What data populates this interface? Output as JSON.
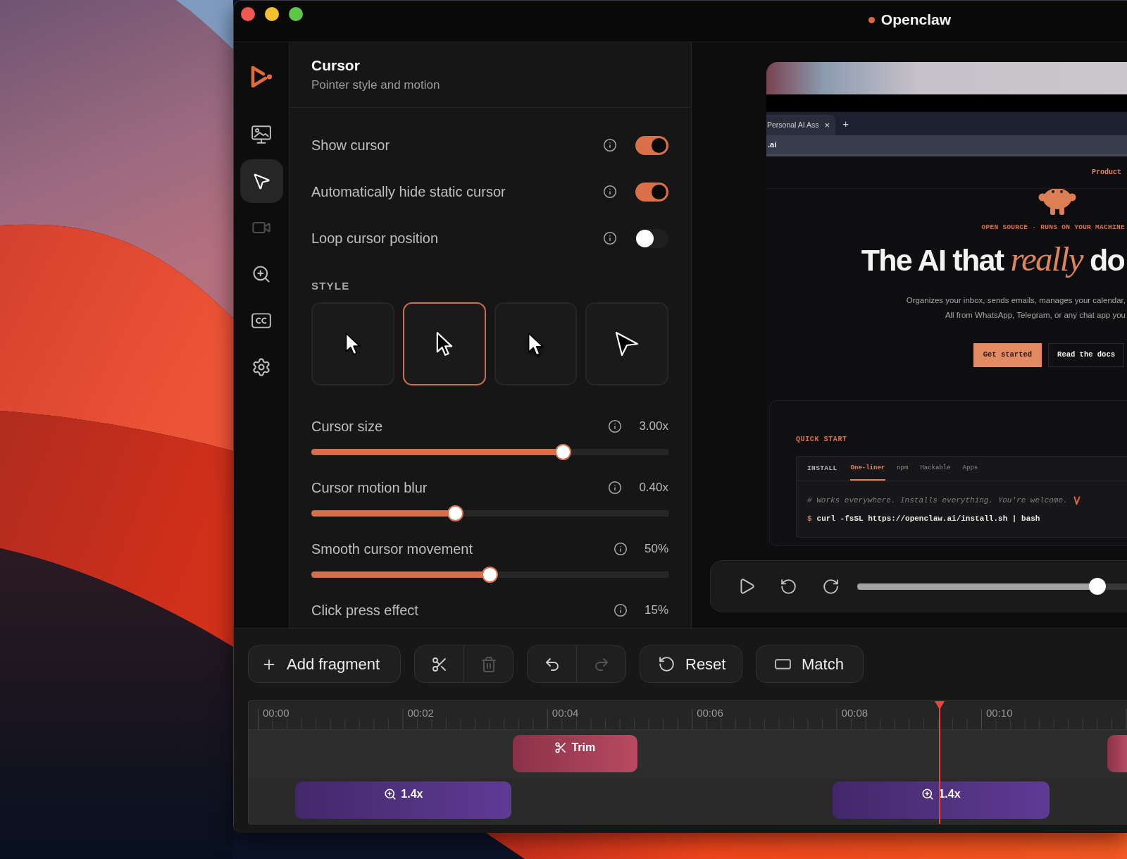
{
  "window": {
    "title": "Openclaw"
  },
  "sidebar": {
    "items": [
      {
        "selected": false,
        "disabled": false
      },
      {
        "selected": true,
        "disabled": false
      },
      {
        "selected": false,
        "disabled": true
      },
      {
        "selected": false,
        "disabled": false
      },
      {
        "selected": false,
        "disabled": false
      },
      {
        "selected": false,
        "disabled": false
      }
    ]
  },
  "panel": {
    "title": "Cursor",
    "subtitle": "Pointer style and motion",
    "toggles": [
      {
        "label": "Show cursor",
        "on": true
      },
      {
        "label": "Automatically hide static cursor",
        "on": true
      },
      {
        "label": "Loop cursor position",
        "on": false
      }
    ],
    "style": {
      "label": "STYLE",
      "options": [
        {
          "selected": false
        },
        {
          "selected": true
        },
        {
          "selected": false
        },
        {
          "selected": false
        }
      ]
    },
    "sliders": [
      {
        "label": "Cursor size",
        "reading": "3.00x",
        "level": 0.706
      },
      {
        "label": "Cursor motion blur",
        "reading": "0.40x",
        "level": 0.404
      },
      {
        "label": "Smooth cursor movement",
        "reading": "50%",
        "level": 0.5
      },
      {
        "label": "Click press effect",
        "reading": "15%"
      }
    ]
  },
  "preview": {
    "browser": {
      "tab": "Personal AI Ass",
      "tab_close": "×",
      "new_tab": "+",
      "address": ".ai"
    },
    "site": {
      "nav": [
        "Product"
      ],
      "eyebrow": "OPEN SOURCE · RUNS ON YOUR MACHINE",
      "headline": "The AI that *really* do",
      "subtitle": [
        "Organizes your inbox, sends emails, manages your calendar,",
        "All from WhatsApp, Telegram, or any chat app you"
      ],
      "buttons": [
        {
          "label": "Get started",
          "kind": "primary"
        },
        {
          "label": "Read the docs",
          "kind": "secondary"
        }
      ],
      "quick_start": {
        "title": "QUICK START",
        "label": "INSTALL",
        "tabs": [
          {
            "label": "One-liner",
            "selected": true
          },
          {
            "label": "npm",
            "selected": false
          },
          {
            "label": "Hackable",
            "selected": false
          },
          {
            "label": "Apps",
            "selected": false
          }
        ],
        "comment": "# Works everywhere. Installs everything. You're welcome.",
        "prompt": "$",
        "command": "curl -fsSL https://openclaw.ai/install.sh | bash"
      }
    },
    "player": {
      "level": 0.89
    }
  },
  "toolbar": {
    "add": "Add fragment",
    "edit_tools": [
      {
        "disabled": false
      },
      {
        "disabled": true
      }
    ],
    "history": [
      {
        "disabled": false
      },
      {
        "disabled": true
      }
    ],
    "reset": "Reset",
    "match": "Match"
  },
  "timeline": {
    "ruler": [
      "00:00",
      "00:02",
      "00:04",
      "00:06",
      "00:08",
      "00:10"
    ],
    "playhead": {
      "level": 0.787
    },
    "tracks": [
      {
        "clips": [
          {
            "kind": "trim",
            "label": "Trim"
          },
          {
            "kind": "trim"
          }
        ]
      },
      {
        "clips": [
          {
            "kind": "zoom",
            "label": "1.4x"
          },
          {
            "kind": "zoom",
            "label": "1.4x"
          }
        ]
      }
    ]
  }
}
